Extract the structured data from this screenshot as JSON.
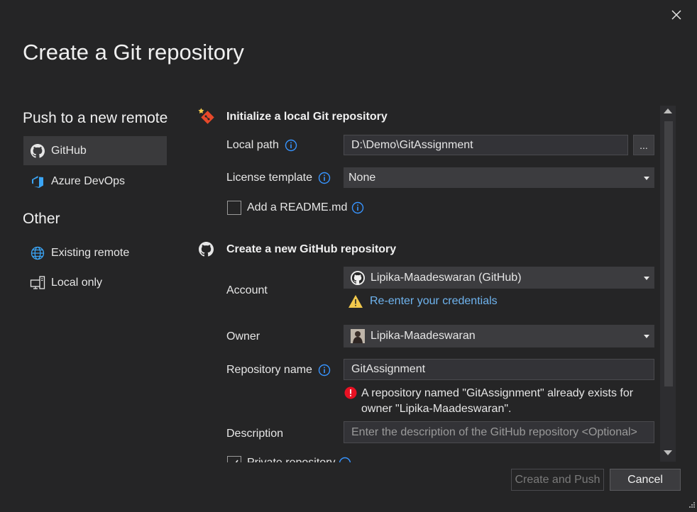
{
  "dialog": {
    "title": "Create a Git repository"
  },
  "sidebar": {
    "push_heading": "Push to a new remote",
    "push_items": [
      {
        "label": "GitHub",
        "icon": "github-icon",
        "selected": true
      },
      {
        "label": "Azure DevOps",
        "icon": "azure-devops-icon",
        "selected": false
      }
    ],
    "other_heading": "Other",
    "other_items": [
      {
        "label": "Existing remote",
        "icon": "globe-icon"
      },
      {
        "label": "Local only",
        "icon": "local-computer-icon"
      }
    ]
  },
  "local_repo": {
    "title": "Initialize a local Git repository",
    "local_path_label": "Local path",
    "local_path_value": "D:\\Demo\\GitAssignment",
    "browse_label": "...",
    "license_label": "License template",
    "license_value": "None",
    "readme_label": "Add a README.md",
    "readme_checked": false
  },
  "github_repo": {
    "title": "Create a new GitHub repository",
    "account_label": "Account",
    "account_value": "Lipika-Maadeswaran (GitHub)",
    "reenter_link": "Re-enter your credentials",
    "owner_label": "Owner",
    "owner_value": "Lipika-Maadeswaran",
    "repo_name_label": "Repository name",
    "repo_name_value": "GitAssignment",
    "error_line1": "A repository named \"GitAssignment\" already exists for",
    "error_line2": "owner \"Lipika-Maadeswaran\".",
    "description_label": "Description",
    "description_placeholder": "Enter the description of the GitHub repository <Optional>",
    "private_label": "Private repository",
    "private_checked": true
  },
  "footer": {
    "create_push_label": "Create and Push",
    "cancel_label": "Cancel"
  },
  "colors": {
    "background": "#252526",
    "accent_link": "#6fb4ef",
    "info_icon": "#3794ff",
    "warning": "#f2c94c",
    "error": "#e81123"
  }
}
